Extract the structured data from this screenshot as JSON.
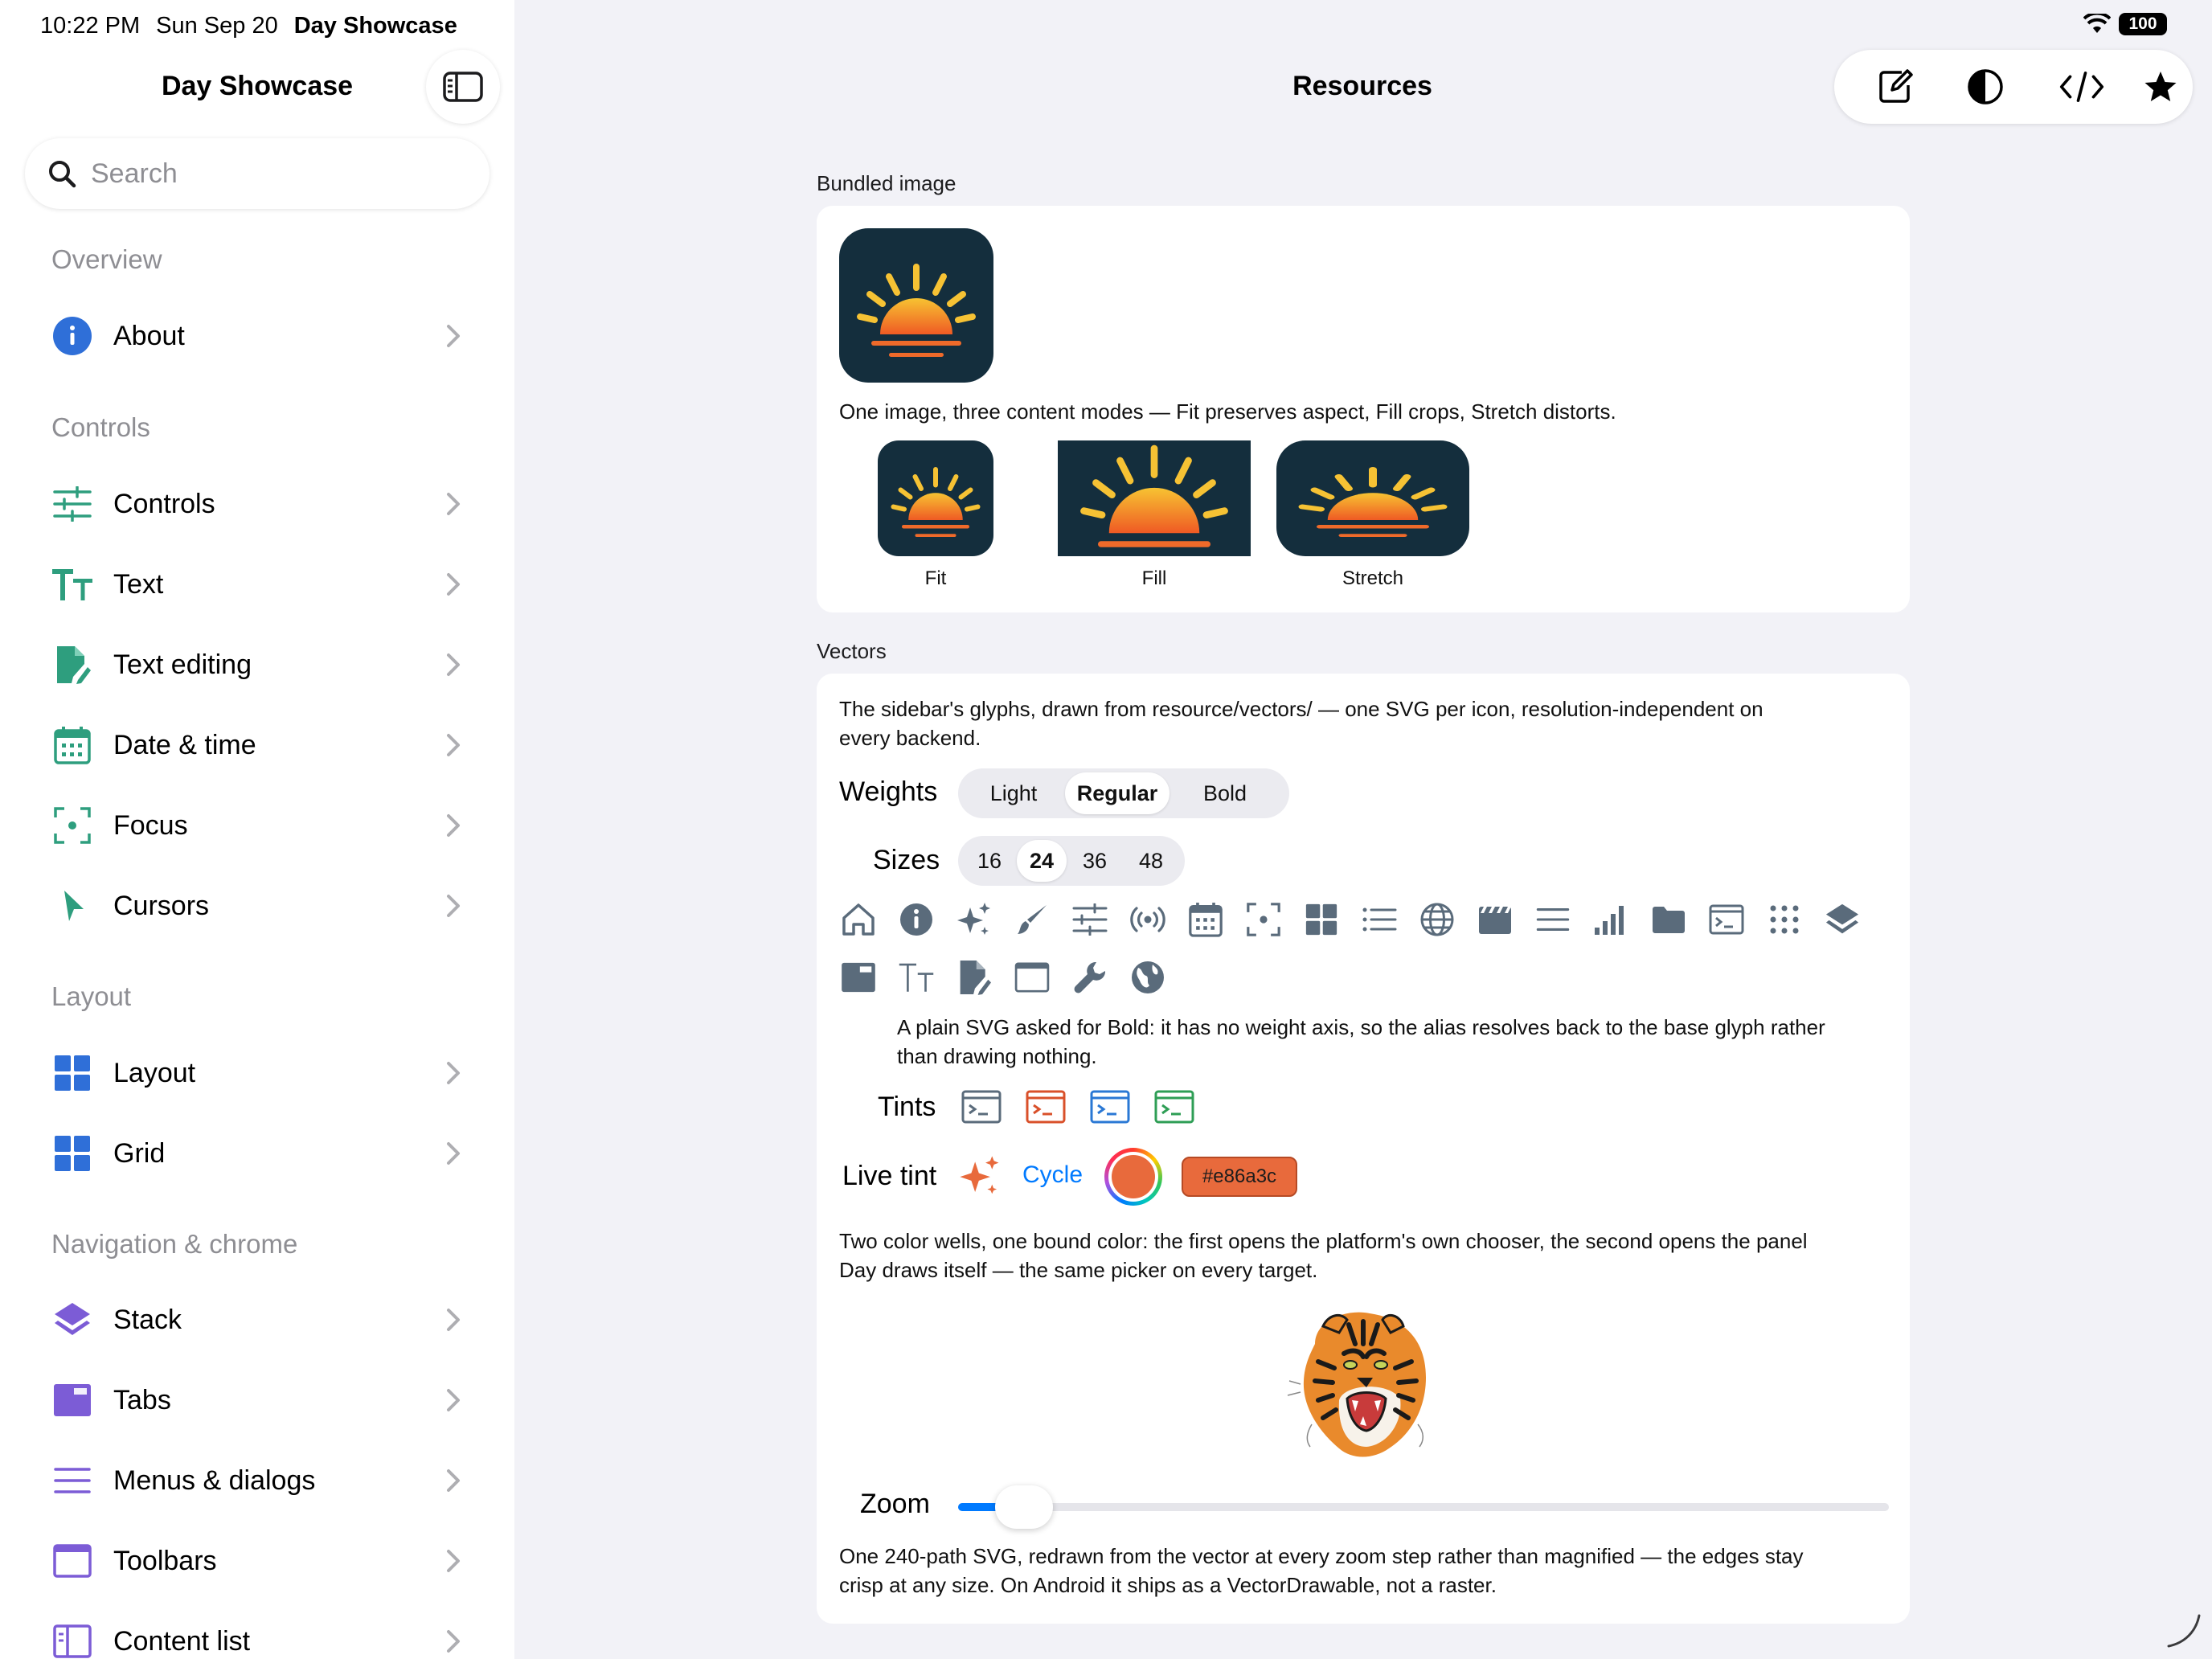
{
  "status": {
    "time": "10:22 PM",
    "date": "Sun Sep 20",
    "app": "Day Showcase",
    "battery": "100"
  },
  "sidebar": {
    "title": "Day Showcase",
    "search_placeholder": "Search",
    "sections": {
      "overview": "Overview",
      "controls": "Controls",
      "layout": "Layout",
      "navigation": "Navigation & chrome"
    },
    "items": [
      {
        "label": "About",
        "icon": "info-icon"
      },
      {
        "label": "Controls",
        "icon": "sliders-icon"
      },
      {
        "label": "Text",
        "icon": "text-size-icon"
      },
      {
        "label": "Text editing",
        "icon": "doc-edit-icon"
      },
      {
        "label": "Date & time",
        "icon": "calendar-icon"
      },
      {
        "label": "Focus",
        "icon": "focus-icon"
      },
      {
        "label": "Cursors",
        "icon": "cursor-icon"
      },
      {
        "label": "Layout",
        "icon": "layout-grid-icon"
      },
      {
        "label": "Grid",
        "icon": "grid-icon"
      },
      {
        "label": "Stack",
        "icon": "stack-icon"
      },
      {
        "label": "Tabs",
        "icon": "tabs-icon"
      },
      {
        "label": "Menus & dialogs",
        "icon": "menu-icon"
      },
      {
        "label": "Toolbars",
        "icon": "window-icon"
      },
      {
        "label": "Content list",
        "icon": "content-list-icon"
      }
    ]
  },
  "header": {
    "title": "Resources"
  },
  "toolbar": {
    "buttons": [
      "compose-icon",
      "contrast-icon",
      "code-icon",
      "star-icon"
    ]
  },
  "bundled": {
    "label": "Bundled image",
    "description": "One image, three content modes — Fit preserves aspect, Fill crops, Stretch distorts.",
    "modes": [
      "Fit",
      "Fill",
      "Stretch"
    ]
  },
  "vectors": {
    "label": "Vectors",
    "description_line1": "The sidebar's glyphs, drawn from resource/vectors/ — one SVG per icon, resolution-independent on",
    "description_line2": "every backend.",
    "weights_label": "Weights",
    "weights": [
      "Light",
      "Regular",
      "Bold"
    ],
    "weights_selected": "Regular",
    "sizes_label": "Sizes",
    "sizes": [
      "16",
      "24",
      "36",
      "48"
    ],
    "sizes_selected": "24",
    "glyph_icons": [
      "home-icon",
      "info-icon",
      "sparkles-icon",
      "brush-icon",
      "sliders-icon",
      "broadcast-icon",
      "calendar-icon",
      "focus-icon",
      "grid-icon",
      "list-icon",
      "globe-icon",
      "clapper-icon",
      "menu-icon",
      "signal-bars-icon",
      "folder-icon",
      "terminal-icon",
      "dots-grid-icon",
      "stack-icon",
      "tabs-icon",
      "text-size-icon",
      "doc-edit-icon",
      "window-icon",
      "wrench-icon",
      "earth-icon"
    ],
    "bold_note_line1": "A plain SVG asked for Bold: it has no weight axis, so the alias resolves back to the base glyph rather",
    "bold_note_line2": "than drawing nothing.",
    "tints_label": "Tints",
    "tint_colors": [
      "#5a6b7b",
      "#d9502a",
      "#2a78d4",
      "#2e9e55"
    ],
    "live_tint_label": "Live tint",
    "cycle_label": "Cycle",
    "live_tint_hex": "#e86a3c",
    "wells_note_line1": "Two color wells, one bound color: the first opens the platform's own chooser, the second opens the panel",
    "wells_note_line2": "Day draws itself — the same picker on every target.",
    "zoom_label": "Zoom",
    "zoom_value": 0.04,
    "svg_note_line1": "One 240-path SVG, redrawn from the vector at every zoom step rather than magnified — the edges stay",
    "svg_note_line2": "crisp at any size. On Android it ships as a VectorDrawable, not a raster."
  },
  "colors": {
    "accent": "#007aff",
    "icon_green": "#2e9e7e",
    "icon_purple": "#7c5cd6",
    "icon_blue": "#2f6fd8",
    "glyph_slate": "#5a6b7b"
  }
}
